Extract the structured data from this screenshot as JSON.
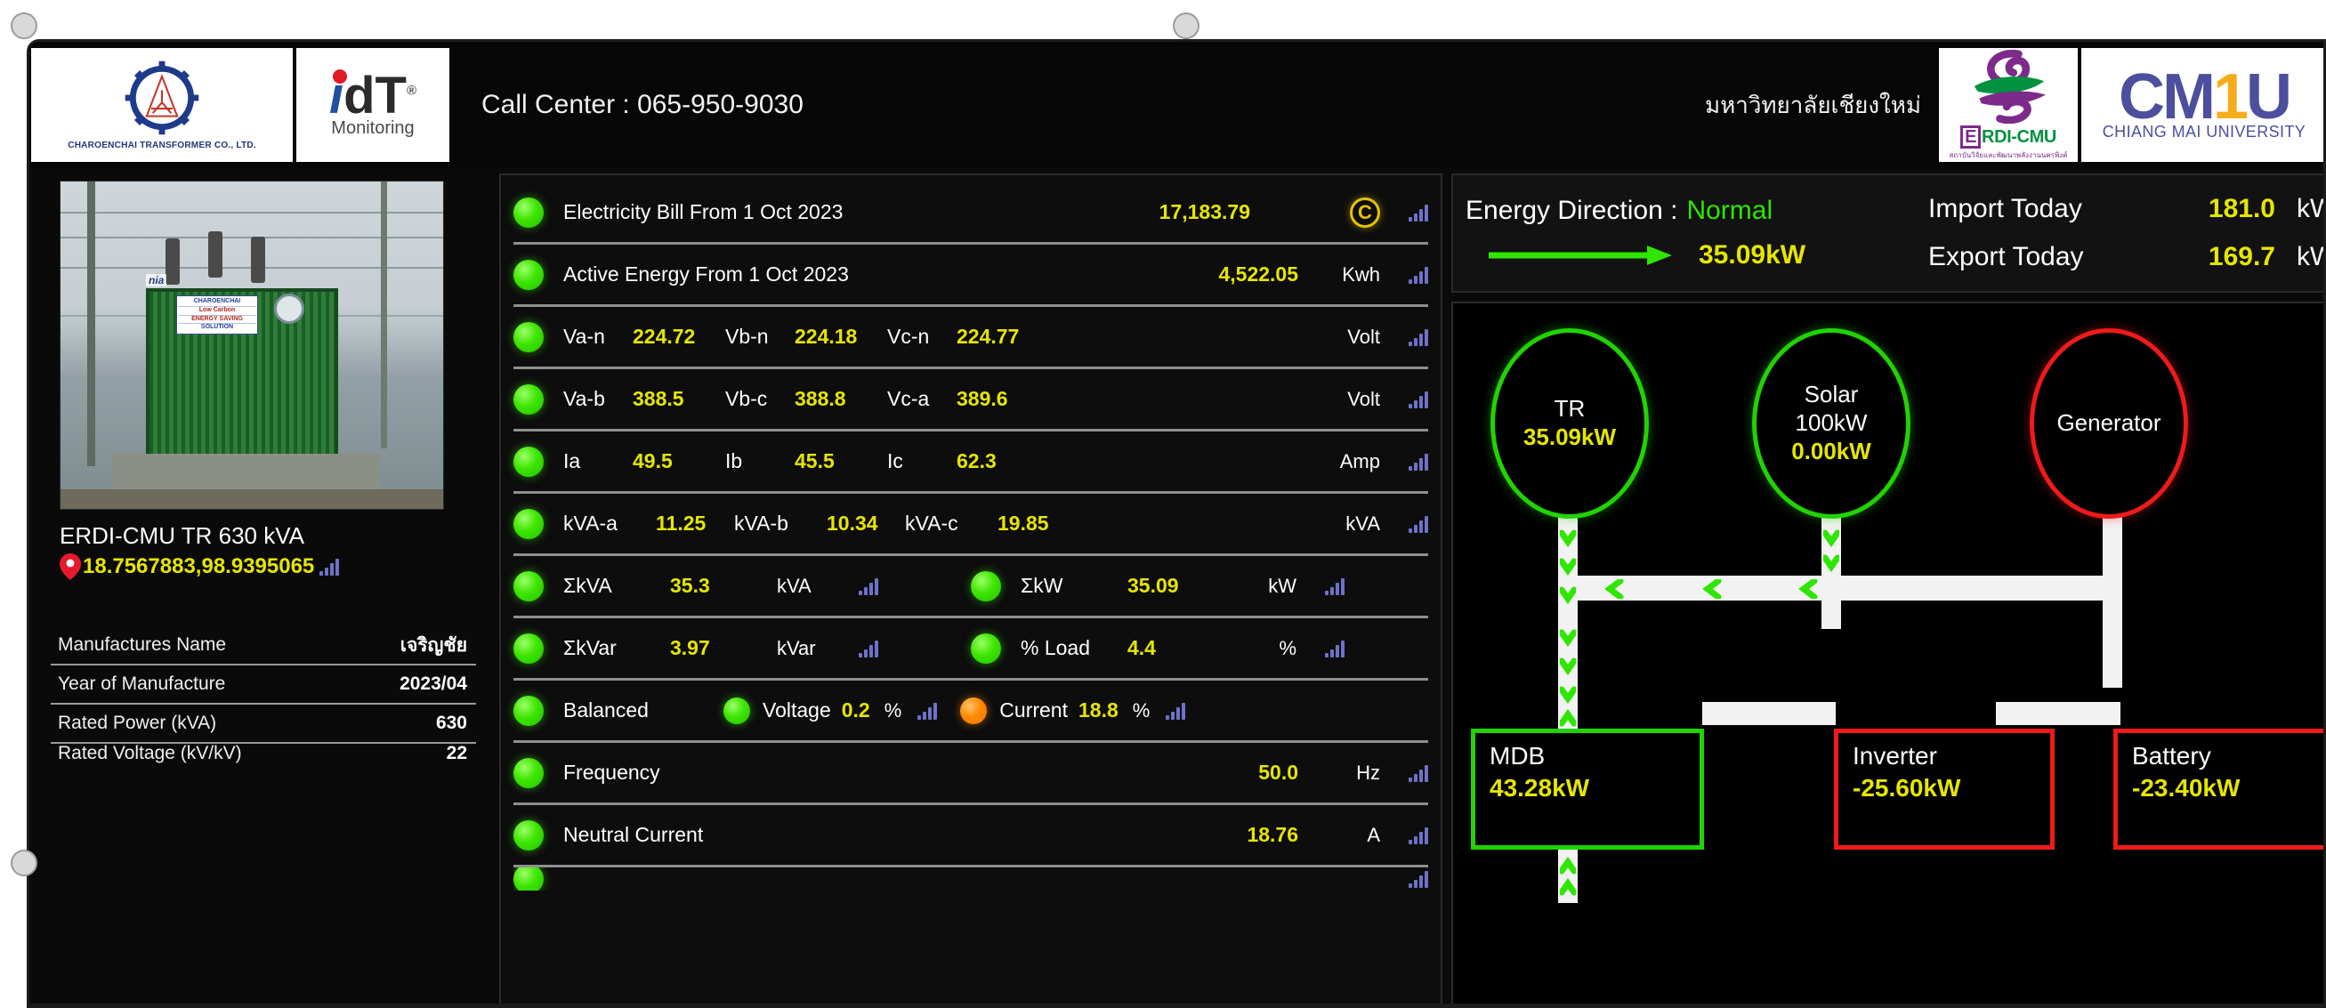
{
  "header": {
    "charoenchai_caption": "CHAROENCHAI TRANSFORMER CO., LTD.",
    "idt_i": "i",
    "idt_d": "d",
    "idt_t": "T",
    "idt_reg": "®",
    "idt_caption": "Monitoring",
    "call_center": "Call Center : 065-950-9030",
    "cmu_thai": "มหาวิทยาลัยเชียงใหม่",
    "erdi_e": "E",
    "erdi_rdi": "RDI-CMU",
    "erdi_sub": "สถาบันวิจัยและพัฒนาพลังงานนครพิงค์",
    "cmu_c": "C",
    "cmu_m": "M",
    "cmu_1": "1",
    "cmu_u": "U",
    "cmu_caption": "CHIANG MAI UNIVERSITY"
  },
  "site": {
    "caption": "ERDI-CMU TR 630 kVA",
    "coords": "18.7567883,98.9395065",
    "pin_icon": "map-pin-icon",
    "photo_plate": {
      "line1": "CHAROENCHAI",
      "line2": "Low Carbon",
      "line3": "ENERGY SAVING",
      "line4": "SOLUTION"
    },
    "nia_tag": "nia"
  },
  "spec_table": {
    "rows": [
      {
        "key": "Manufactures Name",
        "value": "เจริญชัย"
      },
      {
        "key": "Year of Manufacture",
        "value": "2023/04"
      },
      {
        "key": "Rated Power (kVA)",
        "value": "630"
      },
      {
        "key": "Rated Voltage  (kV/kV)",
        "value": "22"
      }
    ]
  },
  "measurements": {
    "rows": [
      {
        "kind": "simple",
        "led": "green",
        "label": "Electricity Bill From 1 Oct 2023",
        "value": "17,183.79",
        "unit": "",
        "icon": "coin-icon",
        "coin_glyph": "C"
      },
      {
        "kind": "simple",
        "led": "green",
        "label": "Active Energy From 1 Oct 2023",
        "value": "4,522.05",
        "unit": "Kwh",
        "icon": "signal-bars-icon"
      },
      {
        "kind": "phase",
        "led": "green",
        "pairs": [
          {
            "label": "Va-n",
            "value": "224.72"
          },
          {
            "label": "Vb-n",
            "value": "224.18"
          },
          {
            "label": "Vc-n",
            "value": "224.77"
          }
        ],
        "unit": "Volt",
        "icon": "signal-bars-icon"
      },
      {
        "kind": "phase",
        "led": "green",
        "pairs": [
          {
            "label": "Va-b",
            "value": "388.5"
          },
          {
            "label": "Vb-c",
            "value": "388.8"
          },
          {
            "label": "Vc-a",
            "value": "389.6"
          }
        ],
        "unit": "Volt",
        "icon": "signal-bars-icon"
      },
      {
        "kind": "phase",
        "led": "green",
        "pairs": [
          {
            "label": "Ia",
            "value": "49.5"
          },
          {
            "label": "Ib",
            "value": "45.5"
          },
          {
            "label": "Ic",
            "value": "62.3"
          }
        ],
        "unit": "Amp",
        "icon": "signal-bars-icon"
      },
      {
        "kind": "phase-wide",
        "led": "green",
        "pairs": [
          {
            "label": "kVA-a",
            "value": "11.25"
          },
          {
            "label": "kVA-b",
            "value": "10.34"
          },
          {
            "label": "kVA-c",
            "value": "19.85"
          }
        ],
        "unit": "kVA",
        "icon": "signal-bars-icon"
      },
      {
        "kind": "dual",
        "left": {
          "led": "green",
          "label": "ΣkVA",
          "value": "35.3",
          "unit": "kVA",
          "icon": "signal-bars-icon"
        },
        "right": {
          "led": "green",
          "label": "ΣkW",
          "value": "35.09",
          "unit": "kW",
          "icon": "signal-bars-icon"
        }
      },
      {
        "kind": "dual",
        "left": {
          "led": "green",
          "label": "ΣkVar",
          "value": "3.97",
          "unit": "kVar",
          "icon": "signal-bars-icon"
        },
        "right": {
          "led": "green",
          "label": "% Load",
          "value": "4.4",
          "unit": "%",
          "icon": "signal-bars-icon"
        }
      },
      {
        "kind": "balance",
        "led": "green",
        "label": "Balanced",
        "voltage": {
          "led": "green",
          "label": "Voltage",
          "value": "0.2",
          "unit": "%",
          "icon": "signal-bars-icon"
        },
        "current": {
          "led": "orange",
          "label": "Current",
          "value": "18.8",
          "unit": "%",
          "icon": "signal-bars-icon"
        }
      },
      {
        "kind": "simple",
        "led": "green",
        "label": "Frequency",
        "value": "50.0",
        "unit": "Hz",
        "icon": "signal-bars-icon"
      },
      {
        "kind": "simple",
        "led": "green",
        "label": "Neutral Current",
        "value": "18.76",
        "unit": "A",
        "icon": "signal-bars-icon"
      }
    ]
  },
  "energy": {
    "direction_label": "Energy Direction :",
    "direction_value": "Normal",
    "direction_color": "#2fe600",
    "flow_icon": "arrow-right-icon",
    "flow_value": "35.09kW",
    "import_label": "Import Today",
    "import_value": "181.0",
    "import_unit": "kWh",
    "export_label": "Export Today",
    "export_value": "169.7",
    "export_unit": "kWh"
  },
  "diagram": {
    "nodes": [
      {
        "id": "tr",
        "shape": "circle",
        "status": "green",
        "title": "TR",
        "value": "35.09kW"
      },
      {
        "id": "solar",
        "shape": "circle",
        "status": "green",
        "title": "Solar",
        "subtitle": "100kW",
        "value": "0.00kW"
      },
      {
        "id": "generator",
        "shape": "circle",
        "status": "red",
        "title": "Generator",
        "value": ""
      },
      {
        "id": "mdb",
        "shape": "box",
        "status": "green",
        "title": "MDB",
        "value": "43.28kW"
      },
      {
        "id": "inverter",
        "shape": "box",
        "status": "red",
        "title": "Inverter",
        "value": "-25.60kW"
      },
      {
        "id": "battery",
        "shape": "box",
        "status": "red",
        "title": "Battery",
        "value": "-23.40kW"
      }
    ],
    "flow_color": "#2fe600",
    "bus_color": "#f2f2f2"
  },
  "colors": {
    "background": "#0a0a0a",
    "value_yellow": "#e6e600",
    "led_green": "#3ee500",
    "led_orange": "#ff8a00",
    "status_red": "#f01a1a",
    "status_green": "#21d300",
    "divider": "#8f8f8f"
  }
}
